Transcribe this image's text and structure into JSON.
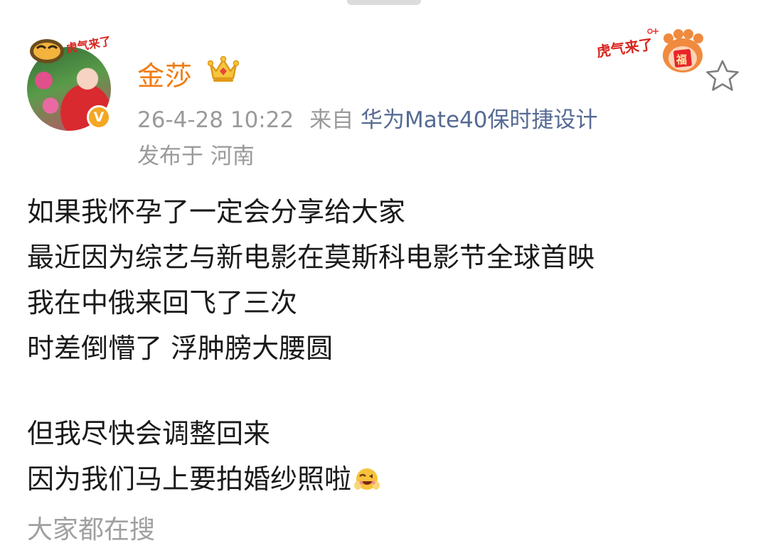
{
  "post": {
    "author": "金莎",
    "avatar_frame_text": "虎气来了",
    "verified_badge": "V",
    "deco_text": "虎气来了",
    "deco_badge": "福",
    "timestamp": "26-4-28 10:22",
    "from_label": "来自",
    "source_device": "华为Mate40保时捷设计",
    "location": "发布于 河南",
    "lines": [
      "如果我怀孕了一定会分享给大家",
      "最近因为综艺与新电影在莫斯科电影节全球首映",
      "我在中俄来回飞了三次",
      "时差倒懵了 浮肿膀大腰圆",
      "但我尽快会调整回来",
      "因为我们马上要拍婚纱照啦"
    ],
    "trending_label": "大家都在搜"
  },
  "icons": {
    "crown": "crown-icon",
    "favorite": "star-icon",
    "emoji": "grin-emoji-icon"
  },
  "colors": {
    "username": "#f07c12",
    "source_link": "#566a93",
    "meta": "#9a9a9a",
    "vip_badge": "#f5a623"
  }
}
